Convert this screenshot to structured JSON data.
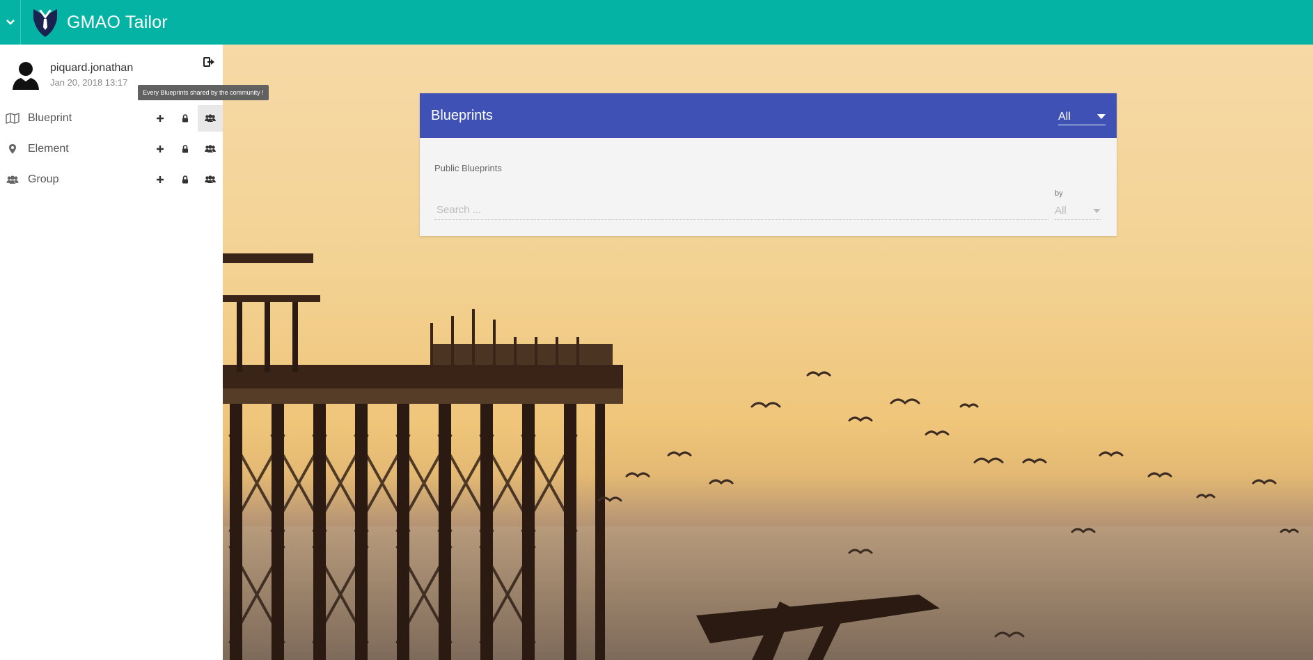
{
  "app": {
    "title": "GMAO Tailor"
  },
  "user": {
    "name": "piquard.jonathan",
    "last_login": "Jan 20, 2018 13:17"
  },
  "tooltip": {
    "text": "Every Blueprints shared by the community !"
  },
  "sidebar": {
    "items": [
      {
        "label": "Blueprint",
        "icon": "map-icon"
      },
      {
        "label": "Element",
        "icon": "map-marker-icon"
      },
      {
        "label": "Group",
        "icon": "group-icon"
      }
    ]
  },
  "card": {
    "title": "Blueprints",
    "filter_value": "All",
    "section_label": "Public Blueprints",
    "search_placeholder": "Search ...",
    "by_label": "by",
    "by_value": "All"
  },
  "colors": {
    "topbar": "#05b3a5",
    "card_header": "#3f51b5",
    "card_body": "#f4f4f4"
  }
}
